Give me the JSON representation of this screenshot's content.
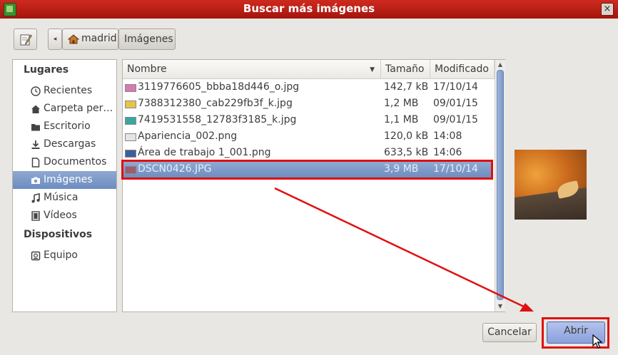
{
  "window": {
    "title": "Buscar más imágenes"
  },
  "toolbar": {
    "path": [
      {
        "label": "madrid",
        "icon": "home-icon"
      },
      {
        "label": "Imágenes"
      }
    ]
  },
  "places": {
    "header_places": "Lugares",
    "header_devices": "Dispositivos",
    "items": [
      {
        "label": "Recientes",
        "icon": "clock-icon"
      },
      {
        "label": "Carpeta per…",
        "icon": "home-icon"
      },
      {
        "label": "Escritorio",
        "icon": "folder-icon"
      },
      {
        "label": "Descargas",
        "icon": "download-icon"
      },
      {
        "label": "Documentos",
        "icon": "document-icon"
      },
      {
        "label": "Imágenes",
        "icon": "camera-icon",
        "selected": true
      },
      {
        "label": "Música",
        "icon": "music-note-icon"
      },
      {
        "label": "Vídeos",
        "icon": "film-icon"
      }
    ],
    "devices": [
      {
        "label": "Equipo",
        "icon": "drive-icon"
      }
    ]
  },
  "filelist": {
    "columns": {
      "name": "Nombre",
      "size": "Tamaño",
      "modified": "Modificado"
    },
    "rows": [
      {
        "name": "3119776605_bbba18d446_o.jpg",
        "size": "142,7 kB",
        "modified": "17/10/14",
        "thumb_color": "#d67ab0"
      },
      {
        "name": "7388312380_cab229fb3f_k.jpg",
        "size": "1,2 MB",
        "modified": "09/01/15",
        "thumb_color": "#e8c34a"
      },
      {
        "name": "7419531558_12783f3185_k.jpg",
        "size": "1,1 MB",
        "modified": "09/01/15",
        "thumb_color": "#3aa6a0"
      },
      {
        "name": "Apariencia_002.png",
        "size": "120,0 kB",
        "modified": "14:08",
        "thumb_color": "#e4e4e4"
      },
      {
        "name": "Área de trabajo 1_001.png",
        "size": "633,5 kB",
        "modified": "14:06",
        "thumb_color": "#3b5f9a"
      },
      {
        "name": "DSCN0426.JPG",
        "size": "3,9 MB",
        "modified": "17/10/14",
        "thumb_color": "#a05a6a",
        "selected": true
      }
    ]
  },
  "buttons": {
    "cancel": "Cancelar",
    "open": "Abrir"
  },
  "colors": {
    "titlebar": "#b81c12",
    "selection": "#7d9ac8",
    "annotation": "#e01010"
  }
}
